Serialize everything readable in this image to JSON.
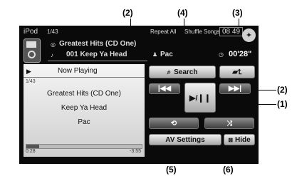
{
  "ipod_label": "iPod",
  "track_counter": "1/43",
  "album_name": "Greatest Hits (CD One)",
  "track_line": "001 Keep Ya Head",
  "repeat_label": "Repeat All",
  "shuffle_label": "Shuffle Songs",
  "clock": "08 49",
  "artist_name": "Pac",
  "elapsed_time": "00'28\"",
  "now_playing_label": "Now Playing",
  "panel_counter": "1/43",
  "panel_album": "Greatest Hits (CD One)",
  "panel_song": "Keep Ya Head",
  "panel_artist": "Pac",
  "progress": {
    "elapsed": "0:28",
    "remaining": "-3:55",
    "fraction": 0.11
  },
  "buttons": {
    "search": "Search",
    "av_settings": "AV Settings",
    "hide": "Hide"
  },
  "callouts": {
    "c1": "(1)",
    "c2a": "(2)",
    "c2b": "(2)",
    "c3": "(3)",
    "c4": "(4)",
    "c5": "(5)",
    "c6": "(6)"
  }
}
